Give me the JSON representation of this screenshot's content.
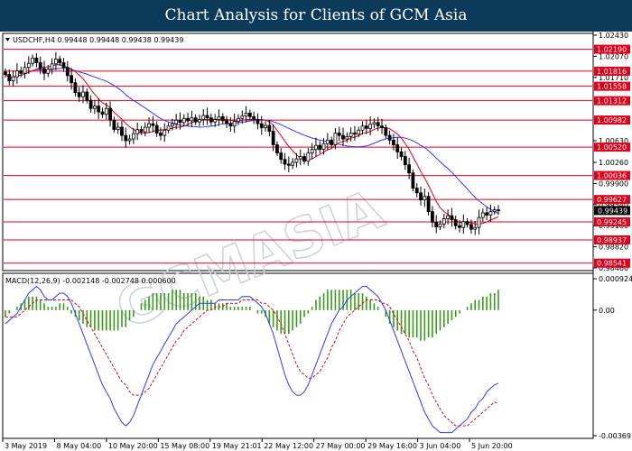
{
  "header": {
    "title": "Chart Analysis for Clients of GCM Asia"
  },
  "watermark": {
    "text": "GCMASIA"
  },
  "price_panel": {
    "info": "USDCHF,H4  0.99448 0.99448 0.99438 0.99439",
    "current_price": "0.99439",
    "current_price_value": 0.99439
  },
  "macd_panel": {
    "info": "MACD(12,26,9) -0.002148 -0.002748 0.000600"
  },
  "colors": {
    "banner": "#0b3a5b",
    "candle": "#000000",
    "level_line": "#e0001a",
    "level_badge": "#e0001a",
    "ma_fast": "#e0001a",
    "ma_slow": "#2c3cff",
    "macd_hist": "#3a9a1a",
    "macd_line": "#2c3cff",
    "macd_signal": "#e0001a"
  },
  "chart_data": {
    "type": "candlestick",
    "symbol": "USDCHF",
    "timeframe": "H4",
    "ylim": [
      0.9846,
      1.0243
    ],
    "price_ticks": [
      {
        "value": 1.0243,
        "label": "1.02430"
      },
      {
        "value": 1.0207,
        "label": "1.02070"
      },
      {
        "value": 1.0171,
        "label": "1.01710"
      },
      {
        "value": 1.0063,
        "label": "1.00630"
      },
      {
        "value": 1.0026,
        "label": "1.00260"
      },
      {
        "value": 0.999,
        "label": "0.99900"
      },
      {
        "value": 0.9954,
        "label": "0.99540"
      },
      {
        "value": 0.9918,
        "label": "0.99180"
      },
      {
        "value": 0.9882,
        "label": "0.98820"
      },
      {
        "value": 0.9846,
        "label": "0.98460"
      }
    ],
    "levels": [
      {
        "value": 1.0219,
        "label": "1.02190"
      },
      {
        "value": 1.01816,
        "label": "1.01816"
      },
      {
        "value": 1.01558,
        "label": "1.01558"
      },
      {
        "value": 1.01312,
        "label": "1.01312"
      },
      {
        "value": 1.00982,
        "label": "1.00982"
      },
      {
        "value": 1.0052,
        "label": "1.00520"
      },
      {
        "value": 1.00036,
        "label": "1.00036"
      },
      {
        "value": 0.99627,
        "label": "0.99627"
      },
      {
        "value": 0.99245,
        "label": "0.99245"
      },
      {
        "value": 0.98937,
        "label": "0.98937"
      },
      {
        "value": 0.98541,
        "label": "0.98541"
      }
    ],
    "x_labels": [
      "3 May 2019",
      "8 May 04:00",
      "10 May 20:00",
      "15 May 08:00",
      "19 May 21:01",
      "22 May 12:00",
      "27 May 00:00",
      "29 May 16:00",
      "3 Jun 04:00",
      "5 Jun 20:00"
    ],
    "candle_count": 128,
    "closes": [
      1.0176,
      1.0165,
      1.0172,
      1.0182,
      1.0178,
      1.0188,
      1.0195,
      1.0204,
      1.0196,
      1.0186,
      1.0178,
      1.0185,
      1.0194,
      1.0202,
      1.0196,
      1.0188,
      1.0174,
      1.0162,
      1.0145,
      1.0138,
      1.0146,
      1.0132,
      1.0118,
      1.0122,
      1.0112,
      1.0108,
      1.0118,
      1.0098,
      1.0082,
      1.0086,
      1.0072,
      1.0063,
      1.0066,
      1.0075,
      1.0082,
      1.0078,
      1.0086,
      1.0092,
      1.0089,
      1.0076,
      1.0072,
      1.0081,
      1.0088,
      1.0092,
      1.0098,
      1.0094,
      1.0101,
      1.0097,
      1.0102,
      1.0095,
      1.0099,
      1.0106,
      1.0102,
      1.0095,
      1.0099,
      1.0104,
      1.0097,
      1.0092,
      1.0088,
      1.0096,
      1.0101,
      1.0105,
      1.011,
      1.0104,
      1.0099,
      1.0092,
      1.0085,
      1.0089,
      1.0079,
      1.0056,
      1.0042,
      1.0031,
      1.0023,
      1.0021,
      1.0026,
      1.0032,
      1.0036,
      1.0028,
      1.0042,
      1.0048,
      1.0055,
      1.0048,
      1.0058,
      1.0064,
      1.0056,
      1.0076,
      1.0072,
      1.0066,
      1.007,
      1.0076,
      1.0074,
      1.0081,
      1.0088,
      1.0084,
      1.0091,
      1.0094,
      1.0088,
      1.0085,
      1.0072,
      1.0064,
      1.0056,
      1.0044,
      1.0036,
      1.0022,
      1.0008,
      0.9982,
      0.9974,
      0.9962,
      0.9968,
      0.9942,
      0.9924,
      0.9916,
      0.9921,
      0.993,
      0.9935,
      0.9928,
      0.9918,
      0.9915,
      0.9925,
      0.992,
      0.9912,
      0.9915,
      0.9932,
      0.994,
      0.9936,
      0.9942,
      0.9945,
      0.99439
    ],
    "macd": {
      "ylim": [
        -0.003691,
        0.000924
      ],
      "ticks": [
        {
          "value": 0.000924,
          "label": "0.000924"
        },
        {
          "value": 0.0,
          "label": "0.00"
        },
        {
          "value": -0.003691,
          "label": "-0.003691"
        }
      ],
      "line": [
        -0.0004,
        -0.0003,
        -0.0002,
        -0.0001,
        0.0001,
        0.0003,
        0.0005,
        0.0006,
        0.0007,
        0.0006,
        0.0004,
        0.0003,
        0.0003,
        0.0004,
        0.0005,
        0.0005,
        0.0004,
        0.0002,
        -0.0001,
        -0.0004,
        -0.0007,
        -0.001,
        -0.0013,
        -0.0016,
        -0.0019,
        -0.0022,
        -0.0024,
        -0.0026,
        -0.0029,
        -0.0031,
        -0.0033,
        -0.0034,
        -0.0033,
        -0.0031,
        -0.0028,
        -0.0025,
        -0.0022,
        -0.0019,
        -0.0016,
        -0.0014,
        -0.0012,
        -0.001,
        -0.0008,
        -0.0006,
        -0.0004,
        -0.0003,
        -0.0002,
        -0.0001,
        0.0,
        0.0001,
        0.0002,
        0.0002,
        0.0002,
        0.0002,
        0.0002,
        0.0003,
        0.0003,
        0.0003,
        0.0003,
        0.0003,
        0.0003,
        0.0004,
        0.0004,
        0.0004,
        0.0003,
        0.0002,
        0.0001,
        -0.0001,
        -0.0004,
        -0.0007,
        -0.0011,
        -0.0015,
        -0.0019,
        -0.0022,
        -0.0024,
        -0.0025,
        -0.0025,
        -0.0024,
        -0.0022,
        -0.0019,
        -0.0016,
        -0.0013,
        -0.001,
        -0.0007,
        -0.0004,
        -0.0002,
        0.0,
        0.0001,
        0.0003,
        0.0004,
        0.0005,
        0.0006,
        0.0007,
        0.0007,
        0.0006,
        0.0005,
        0.0004,
        0.0002,
        0.0,
        -0.0003,
        -0.0006,
        -0.0009,
        -0.0012,
        -0.0015,
        -0.0018,
        -0.0021,
        -0.0024,
        -0.0027,
        -0.003,
        -0.0032,
        -0.0034,
        -0.0035,
        -0.0036,
        -0.0036,
        -0.0036,
        -0.0036,
        -0.0035,
        -0.0034,
        -0.0033,
        -0.0032,
        -0.003,
        -0.0029,
        -0.0027,
        -0.0026,
        -0.0024,
        -0.0023,
        -0.0022,
        -0.002148
      ],
      "histogram": [
        -0.0002,
        -0.0001,
        0.0,
        0.0001,
        0.0002,
        0.0003,
        0.0004,
        0.0004,
        0.0004,
        0.0003,
        0.0002,
        0.0001,
        0.0001,
        0.0001,
        0.0002,
        0.0002,
        0.0001,
        -0.0001,
        -0.0002,
        -0.0003,
        -0.0004,
        -0.0005,
        -0.0005,
        -0.0006,
        -0.0006,
        -0.0006,
        -0.0006,
        -0.0006,
        -0.0006,
        -0.0006,
        -0.0005,
        -0.0005,
        -0.0003,
        -0.0002,
        0.0,
        0.0002,
        0.0003,
        0.0004,
        0.0005,
        0.0005,
        0.0005,
        0.0005,
        0.0005,
        0.0006,
        0.0006,
        0.0006,
        0.0005,
        0.0005,
        0.0005,
        0.0005,
        0.0004,
        0.0004,
        0.0003,
        0.0003,
        0.0002,
        0.0002,
        0.0002,
        0.0002,
        0.0001,
        0.0001,
        0.0001,
        0.0001,
        0.0001,
        0.0001,
        0.0,
        -0.0001,
        -0.0001,
        -0.0002,
        -0.0004,
        -0.0005,
        -0.0006,
        -0.0007,
        -0.0007,
        -0.0007,
        -0.0006,
        -0.0005,
        -0.0004,
        -0.0002,
        -0.0001,
        0.0001,
        0.0003,
        0.0004,
        0.0005,
        0.0006,
        0.0006,
        0.0006,
        0.0006,
        0.0006,
        0.0006,
        0.0006,
        0.0005,
        0.0005,
        0.0005,
        0.0004,
        0.0003,
        0.0002,
        0.0001,
        0.0,
        -0.0002,
        -0.0004,
        -0.0005,
        -0.0006,
        -0.0007,
        -0.0007,
        -0.0008,
        -0.0008,
        -0.0008,
        -0.0009,
        -0.0009,
        -0.0008,
        -0.0008,
        -0.0007,
        -0.0006,
        -0.0005,
        -0.0004,
        -0.0003,
        -0.0002,
        -0.0001,
        0.0,
        0.0001,
        0.0002,
        0.0003,
        0.0003,
        0.0004,
        0.0004,
        0.0005,
        0.0005,
        0.0006
      ],
      "signal": [
        -0.0002,
        -0.0002,
        -0.0002,
        -0.0002,
        -0.0001,
        0.0,
        0.0001,
        0.0002,
        0.0003,
        0.0003,
        0.0003,
        0.0003,
        0.0003,
        0.0003,
        0.0003,
        0.0003,
        0.0003,
        0.0003,
        0.0002,
        0.0001,
        -0.0001,
        -0.0003,
        -0.0005,
        -0.0007,
        -0.0009,
        -0.0011,
        -0.0013,
        -0.0015,
        -0.0017,
        -0.0019,
        -0.0021,
        -0.0022,
        -0.0024,
        -0.0025,
        -0.0025,
        -0.0025,
        -0.0024,
        -0.0023,
        -0.0021,
        -0.0019,
        -0.0017,
        -0.0015,
        -0.0013,
        -0.0011,
        -0.0009,
        -0.0008,
        -0.0006,
        -0.0005,
        -0.0004,
        -0.0003,
        -0.0002,
        -0.0001,
        0.0,
        0.0,
        0.0001,
        0.0001,
        0.0001,
        0.0002,
        0.0002,
        0.0002,
        0.0002,
        0.0003,
        0.0003,
        0.0003,
        0.0003,
        0.0003,
        0.0002,
        0.0002,
        0.0001,
        0.0,
        -0.0002,
        -0.0004,
        -0.0007,
        -0.001,
        -0.0013,
        -0.0016,
        -0.0018,
        -0.0019,
        -0.002,
        -0.002,
        -0.0019,
        -0.0018,
        -0.0016,
        -0.0014,
        -0.0011,
        -0.0009,
        -0.0006,
        -0.0004,
        -0.0002,
        -0.0001,
        0.0,
        0.0001,
        0.0002,
        0.0003,
        0.0003,
        0.0003,
        0.0003,
        0.0002,
        0.0002,
        0.0001,
        -0.0001,
        -0.0003,
        -0.0005,
        -0.0007,
        -0.0009,
        -0.0012,
        -0.0014,
        -0.0017,
        -0.002,
        -0.0022,
        -0.0025,
        -0.0027,
        -0.0029,
        -0.0031,
        -0.0032,
        -0.0033,
        -0.0034,
        -0.0034,
        -0.0034,
        -0.0034,
        -0.0033,
        -0.0032,
        -0.0031,
        -0.003,
        -0.0029,
        -0.0028,
        -0.0027,
        -0.002748
      ]
    }
  }
}
